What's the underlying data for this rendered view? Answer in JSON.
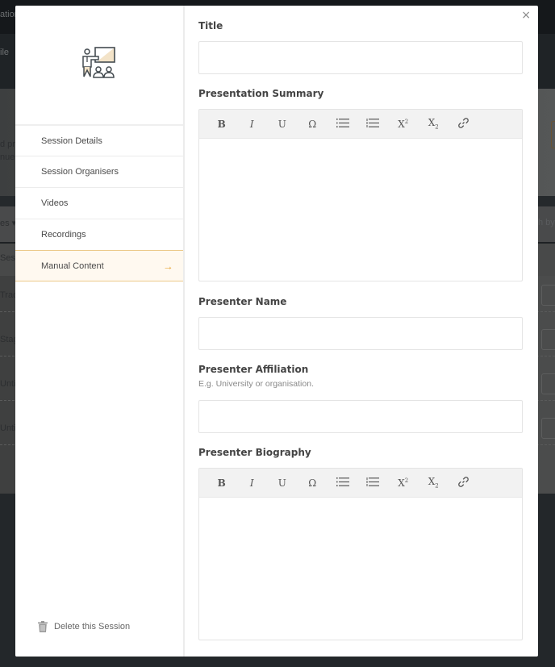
{
  "background": {
    "fragments": {
      "topbar": "ation",
      "header": "ile",
      "hero_line1": "d pr",
      "hero_line2": "nue",
      "filter": "es ▾",
      "filter_right": "h by",
      "thead": "Sess",
      "rows": [
        "Trac",
        "Stag",
        "Unti",
        "Unti"
      ]
    }
  },
  "modal": {
    "close_label": "×",
    "sidebar": {
      "logo_icon": "presentation-icon",
      "nav_items": [
        {
          "label": "Session Details",
          "active": false
        },
        {
          "label": "Session Organisers",
          "active": false
        },
        {
          "label": "Videos",
          "active": false
        },
        {
          "label": "Recordings",
          "active": false
        },
        {
          "label": "Manual Content",
          "active": true
        }
      ],
      "active_arrow": "→",
      "delete_label": "Delete this Session"
    },
    "form": {
      "title": {
        "label": "Title",
        "value": ""
      },
      "presentation_summary": {
        "label": "Presentation Summary",
        "value": ""
      },
      "presenter_name": {
        "label": "Presenter Name",
        "value": ""
      },
      "presenter_affiliation": {
        "label": "Presenter Affiliation",
        "hint": "E.g. University or organisation.",
        "value": ""
      },
      "presenter_biography": {
        "label": "Presenter Biography",
        "value": ""
      }
    },
    "editor_toolbar": [
      {
        "name": "bold",
        "glyph": "B"
      },
      {
        "name": "italic",
        "glyph": "I"
      },
      {
        "name": "underline",
        "glyph": "U"
      },
      {
        "name": "special-character",
        "glyph": "Ω"
      },
      {
        "name": "bulleted-list",
        "glyph": "☰"
      },
      {
        "name": "numbered-list",
        "glyph": "☰"
      },
      {
        "name": "superscript",
        "glyph": "X"
      },
      {
        "name": "subscript",
        "glyph": "X"
      },
      {
        "name": "link",
        "glyph": "🔗"
      }
    ],
    "colors": {
      "accent": "#e8a93e",
      "active_bg": "#fff9f0",
      "active_border": "#ecc98a"
    }
  }
}
